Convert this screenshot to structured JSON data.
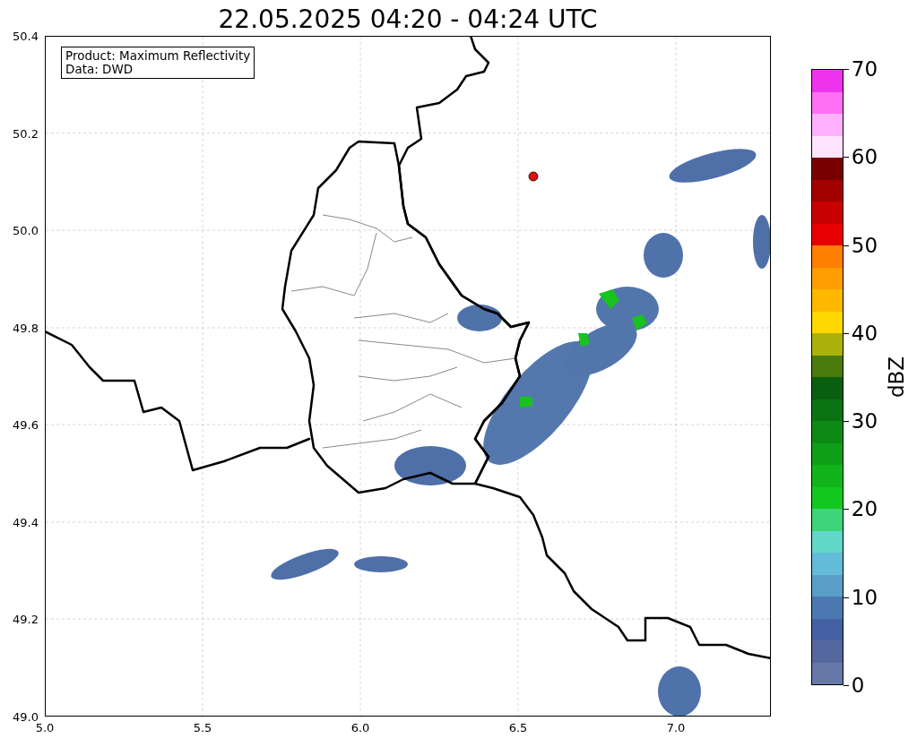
{
  "title": "22.05.2025 04:20 - 04:24 UTC",
  "map": {
    "info_box": [
      "Product: Maximum Reflectivity",
      "Data: DWD"
    ],
    "y_ticks": [
      "50.4",
      "50.2",
      "50.0",
      "49.8",
      "49.6",
      "49.4",
      "49.2",
      "49.0"
    ],
    "x_ticks": [
      "5.0",
      "5.5",
      "6.0",
      "6.5",
      "7.0"
    ]
  },
  "colorbar": {
    "label": "dBZ",
    "ticks": [
      "70",
      "60",
      "50",
      "40",
      "30",
      "20",
      "10",
      "0"
    ],
    "segments": [
      {
        "color": "#6678a8"
      },
      {
        "color": "#55679f"
      },
      {
        "color": "#4560a2"
      },
      {
        "color": "#4b78b0"
      },
      {
        "color": "#5a9ec8"
      },
      {
        "color": "#62bcd8"
      },
      {
        "color": "#62d8c8"
      },
      {
        "color": "#3ed47a"
      },
      {
        "color": "#12c81e"
      },
      {
        "color": "#11b41b"
      },
      {
        "color": "#0f9e18"
      },
      {
        "color": "#0d8a15"
      },
      {
        "color": "#0b7412"
      },
      {
        "color": "#0a5e0f"
      },
      {
        "color": "#4a7a0c"
      },
      {
        "color": "#aab20a"
      },
      {
        "color": "#ffd700"
      },
      {
        "color": "#ffb800"
      },
      {
        "color": "#ff9c00"
      },
      {
        "color": "#ff7f00"
      },
      {
        "color": "#e60000"
      },
      {
        "color": "#c80000"
      },
      {
        "color": "#a40000"
      },
      {
        "color": "#7a0000"
      },
      {
        "color": "#ffe4ff"
      },
      {
        "color": "#ffb0ff"
      },
      {
        "color": "#ff70f5"
      },
      {
        "color": "#ee33ee"
      }
    ]
  }
}
